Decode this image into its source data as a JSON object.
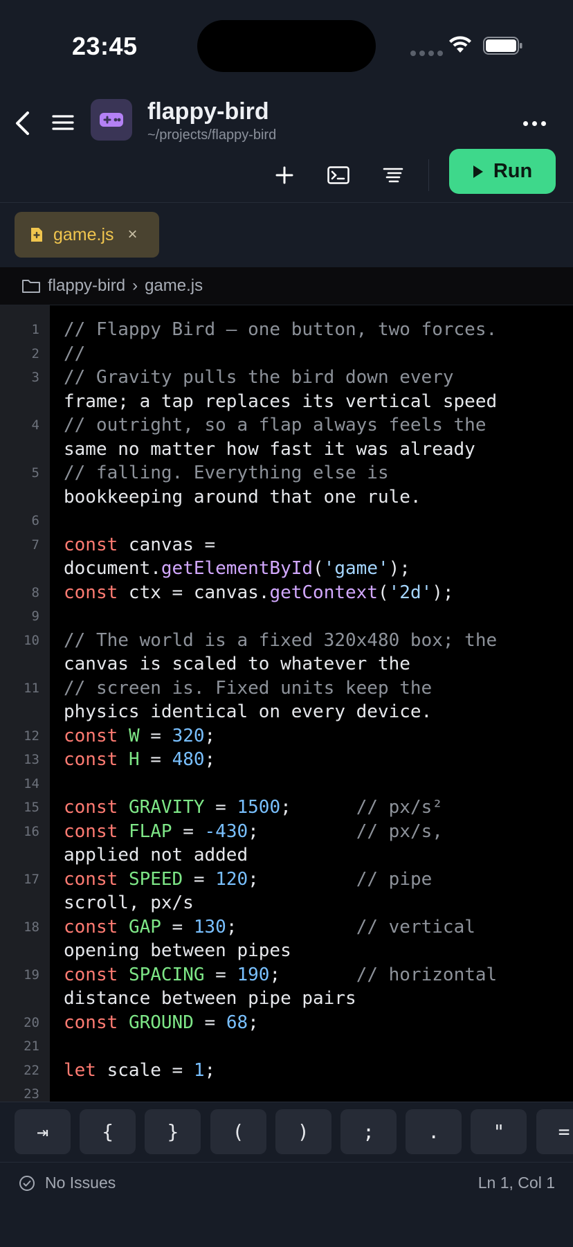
{
  "status_bar": {
    "time": "23:45"
  },
  "header": {
    "title": "flappy-bird",
    "path": "~/projects/flappy-bird",
    "run_label": "Run"
  },
  "tab": {
    "filename": "game.js",
    "close_glyph": "×"
  },
  "breadcrumb": {
    "folder": "flappy-bird",
    "separator": "›",
    "file": "game.js"
  },
  "code_lines": [
    {
      "n": "1",
      "text": "// Flappy Bird — one button, two forces."
    },
    {
      "n": "2",
      "text": "//"
    },
    {
      "n": "3",
      "text": "// Gravity pulls the bird down every frame; a tap replaces its vertical speed"
    },
    {
      "n": "4",
      "text": "// outright, so a flap always feels the same no matter how fast it was already"
    },
    {
      "n": "5",
      "text": "// falling. Everything else is bookkeeping around that one rule."
    },
    {
      "n": "6",
      "text": ""
    },
    {
      "n": "7",
      "text": "const canvas = document.getElementById('game');"
    },
    {
      "n": "8",
      "text": "const ctx = canvas.getContext('2d');"
    },
    {
      "n": "9",
      "text": ""
    },
    {
      "n": "10",
      "text": "// The world is a fixed 320x480 box; the canvas is scaled to whatever the"
    },
    {
      "n": "11",
      "text": "// screen is. Fixed units keep the physics identical on every device."
    },
    {
      "n": "12",
      "text": "const W = 320;"
    },
    {
      "n": "13",
      "text": "const H = 480;"
    },
    {
      "n": "14",
      "text": ""
    },
    {
      "n": "15",
      "text": "const GRAVITY = 1500;      // px/s²"
    },
    {
      "n": "16",
      "text": "const FLAP = -430;         // px/s, applied not added"
    },
    {
      "n": "17",
      "text": "const SPEED = 120;         // pipe scroll, px/s"
    },
    {
      "n": "18",
      "text": "const GAP = 130;           // vertical opening between pipes"
    },
    {
      "n": "19",
      "text": "const SPACING = 190;       // horizontal distance between pipe pairs"
    },
    {
      "n": "20",
      "text": "const GROUND = 68;"
    },
    {
      "n": "21",
      "text": ""
    },
    {
      "n": "22",
      "text": "let scale = 1;"
    },
    {
      "n": "23",
      "text": ""
    }
  ],
  "keys": [
    "⇥",
    "{",
    "}",
    "(",
    ")",
    ";",
    ".",
    "\"",
    "="
  ],
  "footer": {
    "issues": "No Issues",
    "cursor": "Ln 1, Col 1"
  },
  "colors": {
    "run": "#3ed88b",
    "tab_text": "#f0c54e",
    "keyword": "#ff7b72",
    "constant": "#7ee787",
    "number": "#79c0ff",
    "function": "#d2a8ff",
    "string": "#a5d6ff",
    "comment": "#8d929a"
  }
}
